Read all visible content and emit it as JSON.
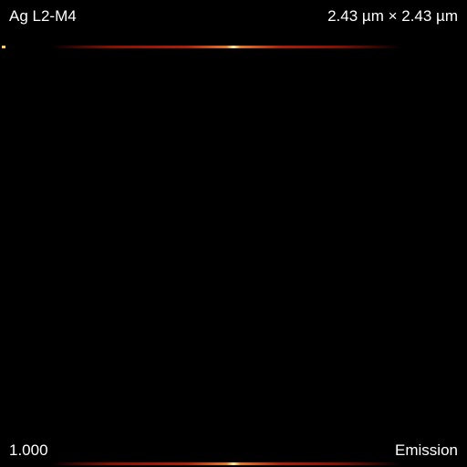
{
  "image": {
    "element_line": "Ag L2-M4",
    "scale": "2.43 µm × 2.43 µm",
    "intensity": "1.000",
    "mode": "Emission"
  },
  "colors": {
    "background": "#000000",
    "text": "#ffffff",
    "emission_dim": "#961200",
    "emission_peak": "#ffebaa"
  }
}
